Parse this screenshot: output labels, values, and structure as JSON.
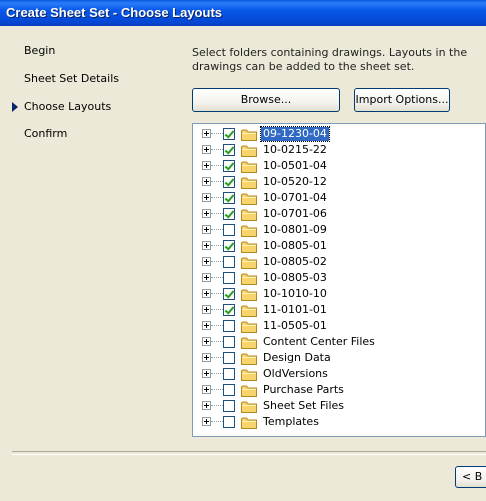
{
  "window": {
    "title": "Create Sheet Set - Choose Layouts"
  },
  "steps": [
    {
      "label": "Begin",
      "current": false
    },
    {
      "label": "Sheet Set Details",
      "current": false
    },
    {
      "label": "Choose Layouts",
      "current": true
    },
    {
      "label": "Confirm",
      "current": false
    }
  ],
  "instructions": "Select folders containing drawings.  Layouts in the drawings can be added to the sheet set.",
  "buttons": {
    "browse": "Browse...",
    "import_options": "Import Options...",
    "back": "< B"
  },
  "tree": {
    "items": [
      {
        "label": "09-1230-04",
        "checked": true,
        "selected": true
      },
      {
        "label": "10-0215-22",
        "checked": true,
        "selected": false
      },
      {
        "label": "10-0501-04",
        "checked": true,
        "selected": false
      },
      {
        "label": "10-0520-12",
        "checked": true,
        "selected": false
      },
      {
        "label": "10-0701-04",
        "checked": true,
        "selected": false
      },
      {
        "label": "10-0701-06",
        "checked": true,
        "selected": false
      },
      {
        "label": "10-0801-09",
        "checked": false,
        "selected": false
      },
      {
        "label": "10-0805-01",
        "checked": true,
        "selected": false
      },
      {
        "label": "10-0805-02",
        "checked": false,
        "selected": false
      },
      {
        "label": "10-0805-03",
        "checked": false,
        "selected": false
      },
      {
        "label": "10-1010-10",
        "checked": true,
        "selected": false
      },
      {
        "label": "11-0101-01",
        "checked": true,
        "selected": false
      },
      {
        "label": "11-0505-01",
        "checked": false,
        "selected": false
      },
      {
        "label": "Content Center Files",
        "checked": false,
        "selected": false
      },
      {
        "label": "Design Data",
        "checked": false,
        "selected": false
      },
      {
        "label": "OldVersions",
        "checked": false,
        "selected": false
      },
      {
        "label": "Purchase Parts",
        "checked": false,
        "selected": false
      },
      {
        "label": "Sheet Set Files",
        "checked": false,
        "selected": false
      },
      {
        "label": "Templates",
        "checked": false,
        "selected": false
      }
    ]
  },
  "colors": {
    "titlebar": "#0547D4",
    "dialog_bg": "#ECE9D8",
    "selection": "#316AC5",
    "check": "#21A121",
    "folder": "#F5D56B"
  }
}
